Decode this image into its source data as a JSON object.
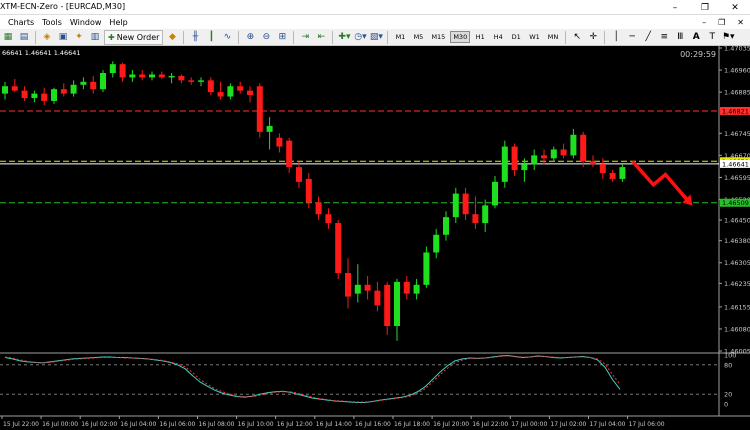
{
  "window": {
    "title": "XTM-ECN-Zero - [EURCAD,M30]",
    "controls": [
      "–",
      "❐",
      "✕"
    ]
  },
  "menu": {
    "items": [
      "Charts",
      "Tools",
      "Window",
      "Help"
    ],
    "doc_controls": [
      "–",
      "❐",
      "✕"
    ]
  },
  "toolbar": {
    "new_order_label": "New Order",
    "timeframes": [
      "M1",
      "M5",
      "M15",
      "M30",
      "H1",
      "H4",
      "D1",
      "W1",
      "MN"
    ],
    "active_timeframe": "M30"
  },
  "chart": {
    "ohlc_header": "66641 1.46641 1.46641",
    "countdown": "00:29:59",
    "price_axis": [
      "1.47035",
      "1.46960",
      "1.46885",
      "1.46745",
      "1.46670",
      "1.46595",
      "1.46520",
      "1.46450",
      "1.46380",
      "1.46305",
      "1.46235",
      "1.46155",
      "1.46080",
      "1.46005"
    ],
    "price_badges": [
      {
        "value": "1.46821",
        "color": "#ff3030"
      },
      {
        "value": "1.46650",
        "color": "#e8e800"
      },
      {
        "value": "1.46641",
        "color": "#ffffff"
      },
      {
        "value": "1.46509",
        "color": "#28c028"
      }
    ],
    "indicator_axis": [
      "100",
      "80",
      "20",
      "0"
    ],
    "time_axis": [
      "15 Jul 22:00",
      "16 Jul 00:00",
      "16 Jul 02:00",
      "16 Jul 04:00",
      "16 Jul 06:00",
      "16 Jul 08:00",
      "16 Jul 10:00",
      "16 Jul 12:00",
      "16 Jul 14:00",
      "16 Jul 16:00",
      "16 Jul 18:00",
      "16 Jul 20:00",
      "16 Jul 22:00",
      "17 Jul 00:00",
      "17 Jul 02:00",
      "17 Jul 04:00",
      "17 Jul 06:00"
    ],
    "colors": {
      "bull": "#1fe01f",
      "bear": "#ff1a1a",
      "grid": "#2a2a2a",
      "stoch_main": "#3fd0c8",
      "stoch_signal": "#ff3030",
      "forecast_arrow": "#ff1010"
    }
  },
  "chart_data": {
    "type": "candlestick",
    "symbol": "EURCAD",
    "timeframe": "M30",
    "ylim": [
      1.46005,
      1.47035
    ],
    "horizontal_lines": [
      {
        "price": 1.46821,
        "color": "#ff3030",
        "style": "dashed"
      },
      {
        "price": 1.4665,
        "color": "#e8e800",
        "style": "dashed"
      },
      {
        "price": 1.46641,
        "color": "#ffffff",
        "style": "solid"
      },
      {
        "price": 1.46509,
        "color": "#28c028",
        "style": "dashed"
      }
    ],
    "candles": [
      {
        "o": 1.4688,
        "h": 1.4692,
        "l": 1.4686,
        "c": 1.46905
      },
      {
        "o": 1.46905,
        "h": 1.4693,
        "l": 1.46885,
        "c": 1.4689
      },
      {
        "o": 1.4689,
        "h": 1.46905,
        "l": 1.46855,
        "c": 1.46865
      },
      {
        "o": 1.46865,
        "h": 1.4689,
        "l": 1.4685,
        "c": 1.4688
      },
      {
        "o": 1.4688,
        "h": 1.469,
        "l": 1.4684,
        "c": 1.46855
      },
      {
        "o": 1.46855,
        "h": 1.469,
        "l": 1.46845,
        "c": 1.46895
      },
      {
        "o": 1.46895,
        "h": 1.46915,
        "l": 1.4687,
        "c": 1.4688
      },
      {
        "o": 1.4688,
        "h": 1.46925,
        "l": 1.4687,
        "c": 1.4691
      },
      {
        "o": 1.4691,
        "h": 1.46935,
        "l": 1.46895,
        "c": 1.4692
      },
      {
        "o": 1.4692,
        "h": 1.4694,
        "l": 1.4688,
        "c": 1.46895
      },
      {
        "o": 1.46895,
        "h": 1.4696,
        "l": 1.46885,
        "c": 1.4695
      },
      {
        "o": 1.4695,
        "h": 1.4699,
        "l": 1.46935,
        "c": 1.4698
      },
      {
        "o": 1.4698,
        "h": 1.46985,
        "l": 1.4692,
        "c": 1.46935
      },
      {
        "o": 1.46935,
        "h": 1.4696,
        "l": 1.4692,
        "c": 1.46945
      },
      {
        "o": 1.46945,
        "h": 1.4696,
        "l": 1.46925,
        "c": 1.46935
      },
      {
        "o": 1.46935,
        "h": 1.46955,
        "l": 1.46925,
        "c": 1.46945
      },
      {
        "o": 1.46945,
        "h": 1.46955,
        "l": 1.4693,
        "c": 1.46935
      },
      {
        "o": 1.46935,
        "h": 1.4695,
        "l": 1.46915,
        "c": 1.4694
      },
      {
        "o": 1.4694,
        "h": 1.46945,
        "l": 1.46915,
        "c": 1.46925
      },
      {
        "o": 1.46925,
        "h": 1.46935,
        "l": 1.4691,
        "c": 1.4692
      },
      {
        "o": 1.4692,
        "h": 1.46935,
        "l": 1.46905,
        "c": 1.46925
      },
      {
        "o": 1.46925,
        "h": 1.46935,
        "l": 1.46875,
        "c": 1.46885
      },
      {
        "o": 1.46885,
        "h": 1.4692,
        "l": 1.4686,
        "c": 1.4687
      },
      {
        "o": 1.4687,
        "h": 1.46915,
        "l": 1.4686,
        "c": 1.46905
      },
      {
        "o": 1.46905,
        "h": 1.4692,
        "l": 1.4688,
        "c": 1.4689
      },
      {
        "o": 1.4689,
        "h": 1.46905,
        "l": 1.4685,
        "c": 1.46875
      },
      {
        "o": 1.46905,
        "h": 1.46915,
        "l": 1.4673,
        "c": 1.4675
      },
      {
        "o": 1.4675,
        "h": 1.468,
        "l": 1.4669,
        "c": 1.4677
      },
      {
        "o": 1.4673,
        "h": 1.46745,
        "l": 1.4668,
        "c": 1.467
      },
      {
        "o": 1.4672,
        "h": 1.4673,
        "l": 1.4661,
        "c": 1.4663
      },
      {
        "o": 1.4663,
        "h": 1.4665,
        "l": 1.4656,
        "c": 1.4658
      },
      {
        "o": 1.4659,
        "h": 1.4661,
        "l": 1.4649,
        "c": 1.4651
      },
      {
        "o": 1.4651,
        "h": 1.4653,
        "l": 1.4645,
        "c": 1.4647
      },
      {
        "o": 1.4647,
        "h": 1.4649,
        "l": 1.4642,
        "c": 1.4644
      },
      {
        "o": 1.4644,
        "h": 1.4645,
        "l": 1.4625,
        "c": 1.4627
      },
      {
        "o": 1.4627,
        "h": 1.4632,
        "l": 1.4615,
        "c": 1.4619
      },
      {
        "o": 1.462,
        "h": 1.463,
        "l": 1.4617,
        "c": 1.4623
      },
      {
        "o": 1.4623,
        "h": 1.4626,
        "l": 1.4618,
        "c": 1.4621
      },
      {
        "o": 1.4621,
        "h": 1.4624,
        "l": 1.4614,
        "c": 1.4616
      },
      {
        "o": 1.4623,
        "h": 1.4624,
        "l": 1.4606,
        "c": 1.4609
      },
      {
        "o": 1.4609,
        "h": 1.4625,
        "l": 1.4604,
        "c": 1.4624
      },
      {
        "o": 1.4624,
        "h": 1.4626,
        "l": 1.4618,
        "c": 1.462
      },
      {
        "o": 1.462,
        "h": 1.4625,
        "l": 1.4618,
        "c": 1.4623
      },
      {
        "o": 1.4623,
        "h": 1.4636,
        "l": 1.4622,
        "c": 1.4634
      },
      {
        "o": 1.4634,
        "h": 1.4642,
        "l": 1.4632,
        "c": 1.464
      },
      {
        "o": 1.464,
        "h": 1.4648,
        "l": 1.4638,
        "c": 1.4646
      },
      {
        "o": 1.4646,
        "h": 1.4656,
        "l": 1.4644,
        "c": 1.4654
      },
      {
        "o": 1.4654,
        "h": 1.4656,
        "l": 1.4645,
        "c": 1.4647
      },
      {
        "o": 1.4647,
        "h": 1.4653,
        "l": 1.4642,
        "c": 1.4644
      },
      {
        "o": 1.4644,
        "h": 1.4652,
        "l": 1.4641,
        "c": 1.465
      },
      {
        "o": 1.465,
        "h": 1.466,
        "l": 1.4649,
        "c": 1.4658
      },
      {
        "o": 1.4658,
        "h": 1.4672,
        "l": 1.4656,
        "c": 1.467
      },
      {
        "o": 1.467,
        "h": 1.4671,
        "l": 1.466,
        "c": 1.4662
      },
      {
        "o": 1.4662,
        "h": 1.4666,
        "l": 1.4658,
        "c": 1.4664
      },
      {
        "o": 1.4664,
        "h": 1.4669,
        "l": 1.4662,
        "c": 1.4667
      },
      {
        "o": 1.4667,
        "h": 1.4669,
        "l": 1.4664,
        "c": 1.4666
      },
      {
        "o": 1.4666,
        "h": 1.467,
        "l": 1.4665,
        "c": 1.4669
      },
      {
        "o": 1.4669,
        "h": 1.4671,
        "l": 1.4666,
        "c": 1.4667
      },
      {
        "o": 1.4667,
        "h": 1.4676,
        "l": 1.4666,
        "c": 1.4674
      },
      {
        "o": 1.4674,
        "h": 1.4675,
        "l": 1.4663,
        "c": 1.4665
      },
      {
        "o": 1.4665,
        "h": 1.4667,
        "l": 1.4663,
        "c": 1.4664
      },
      {
        "o": 1.4664,
        "h": 1.4666,
        "l": 1.4659,
        "c": 1.4661
      },
      {
        "o": 1.4661,
        "h": 1.4662,
        "l": 1.4658,
        "c": 1.4659
      },
      {
        "o": 1.4659,
        "h": 1.4664,
        "l": 1.4658,
        "c": 1.4663
      }
    ],
    "forecast_arrow": [
      [
        1.4665,
        0
      ],
      [
        1.4657,
        7
      ],
      [
        1.46605,
        11
      ],
      [
        1.4651,
        19
      ]
    ],
    "stochastic": {
      "levels": [
        20,
        80
      ],
      "ylim": [
        0,
        100
      ],
      "main": [
        95,
        92,
        88,
        86,
        85,
        84,
        86,
        88,
        90,
        92,
        93,
        94,
        95,
        96,
        96,
        95,
        95,
        94,
        93,
        92,
        90,
        88,
        85,
        80,
        72,
        58,
        45,
        36,
        28,
        22,
        18,
        15,
        14,
        16,
        20,
        23,
        25,
        26,
        24,
        20,
        16,
        12,
        10,
        8,
        6,
        5,
        4,
        3,
        3,
        5,
        8,
        10,
        12,
        14,
        18,
        25,
        35,
        50,
        65,
        78,
        88,
        92,
        94,
        93,
        94,
        96,
        98,
        99,
        97,
        95,
        96,
        98,
        97,
        95,
        94,
        95,
        96,
        97,
        95,
        90,
        75,
        50,
        30
      ],
      "signal": [
        96,
        94,
        90,
        87,
        85,
        84,
        85,
        87,
        89,
        91,
        92,
        93,
        94,
        95,
        95,
        95,
        94,
        94,
        93,
        92,
        91,
        89,
        86,
        82,
        76,
        64,
        50,
        40,
        31,
        25,
        20,
        16,
        15,
        15,
        18,
        21,
        24,
        25,
        25,
        22,
        18,
        14,
        11,
        9,
        7,
        6,
        5,
        4,
        4,
        5,
        7,
        9,
        11,
        13,
        16,
        22,
        31,
        45,
        60,
        73,
        84,
        90,
        93,
        93,
        94,
        95,
        97,
        98,
        97,
        96,
        96,
        97,
        97,
        96,
        95,
        95,
        96,
        96,
        95,
        92,
        82,
        60,
        40
      ]
    }
  }
}
